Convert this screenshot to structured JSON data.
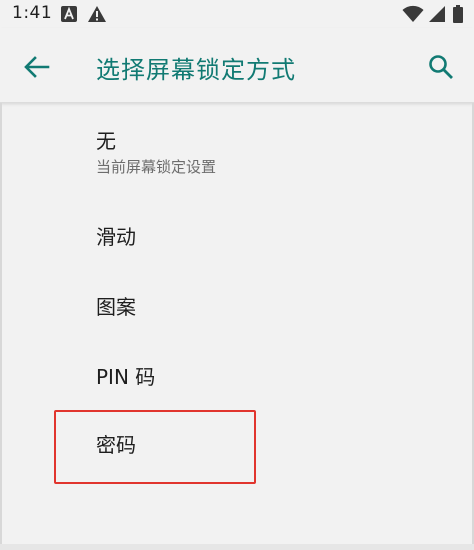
{
  "status_bar": {
    "time": "1:41",
    "icons": [
      "a-box-icon",
      "warning-icon",
      "wifi-icon",
      "cellular-signal-icon",
      "battery-icon"
    ]
  },
  "toolbar": {
    "title": "选择屏幕锁定方式",
    "back_icon": "back-arrow-icon",
    "search_icon": "search-icon"
  },
  "lock_options": [
    {
      "title": "无",
      "summary": "当前屏幕锁定设置"
    },
    {
      "title": "滑动"
    },
    {
      "title": "图案"
    },
    {
      "title": "PIN 码"
    },
    {
      "title": "密码"
    }
  ],
  "colors": {
    "accent": "#117a73",
    "background": "#f2f2f2",
    "highlight": "#e1352e",
    "text_primary": "#1e1e1e",
    "text_secondary": "#6d6d6d"
  }
}
